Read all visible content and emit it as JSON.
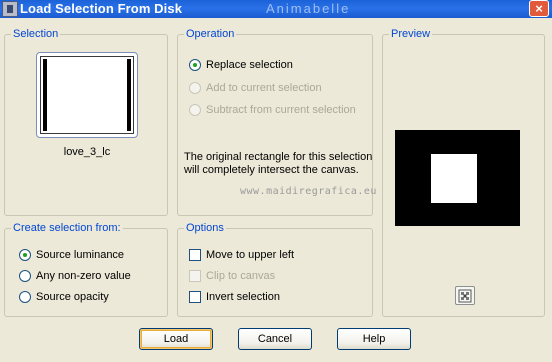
{
  "window": {
    "title": "Load Selection From Disk",
    "close_glyph": "×",
    "watermark_top": "Animabelle"
  },
  "selection": {
    "legend": "Selection",
    "file_name": "love_3_lc"
  },
  "operation": {
    "legend": "Operation",
    "options": [
      {
        "label": "Replace selection",
        "checked": true,
        "enabled": true
      },
      {
        "label": "Add to current selection",
        "checked": false,
        "enabled": false
      },
      {
        "label": "Subtract from current selection",
        "checked": false,
        "enabled": false
      }
    ],
    "info_line1": "The original rectangle for this selection",
    "info_line2": "will completely intersect the canvas.",
    "watermark": "www.maidiregrafica.eu"
  },
  "preview": {
    "legend": "Preview",
    "zoom_icon": "zoom-preview-icon"
  },
  "create_from": {
    "legend": "Create selection from:",
    "options": [
      {
        "label": "Source luminance",
        "checked": true
      },
      {
        "label": "Any non-zero value",
        "checked": false
      },
      {
        "label": "Source opacity",
        "checked": false
      }
    ]
  },
  "options": {
    "legend": "Options",
    "items": [
      {
        "label": "Move to upper left",
        "checked": false,
        "enabled": true
      },
      {
        "label": "Clip to canvas",
        "checked": false,
        "enabled": false
      },
      {
        "label": "Invert selection",
        "checked": false,
        "enabled": true
      }
    ]
  },
  "buttons": {
    "load": "Load",
    "cancel": "Cancel",
    "help": "Help"
  },
  "colors": {
    "titlebar": "#2a71e8",
    "legend": "#0046d5",
    "face": "#ece9d8"
  }
}
